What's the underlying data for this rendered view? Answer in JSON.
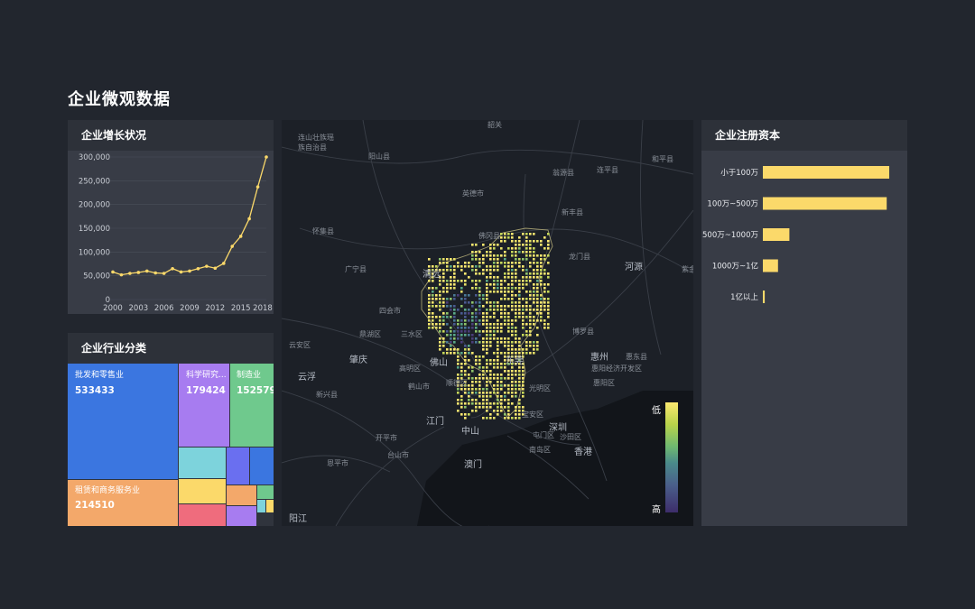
{
  "page": {
    "title": "企业微观数据"
  },
  "growth": {
    "title": "企业增长状况"
  },
  "industry": {
    "title": "企业行业分类",
    "cells": [
      {
        "label": "批发和零售业",
        "value": "533433",
        "color": "#3b76e0"
      },
      {
        "label": "科学研究...",
        "value": "179424",
        "color": "#a77cf0"
      },
      {
        "label": "制造业",
        "value": "152579",
        "color": "#6fc98d"
      },
      {
        "label": "租赁和商务服务业",
        "value": "214510",
        "color": "#f3a86a"
      }
    ],
    "minor_colors": [
      "#7dd3dc",
      "#6a6ff0",
      "#3b76e0",
      "#fbd96a",
      "#f3a86a",
      "#ef6c7d",
      "#a77cf0",
      "#6fc98d",
      "#7dd3dc",
      "#fbd96a"
    ]
  },
  "map": {
    "legend": {
      "low": "低",
      "high": "高"
    },
    "places": [
      "连山壮族瑶族自治县",
      "阳山县",
      "英德市",
      "翁源县",
      "连平县",
      "和平县",
      "怀集县",
      "佛冈县",
      "新丰县",
      "广宁县",
      "清远",
      "龙门县",
      "河源",
      "紫金",
      "四会市",
      "鼎湖区",
      "三水区",
      "博罗县",
      "云安区",
      "肇庆",
      "佛山",
      "东莞",
      "惠州",
      "惠东县",
      "高明区",
      "惠阳经济开发区",
      "云浮",
      "鹤山市",
      "顺德区",
      "惠阳区",
      "光明区",
      "新兴县",
      "江门",
      "宝安区",
      "中山",
      "深圳",
      "开平市",
      "屯门区",
      "沙田区",
      "台山市",
      "南岛区",
      "香港",
      "恩平市",
      "澳门",
      "阳江",
      "韶关"
    ],
    "colors": {
      "low": "#fbe870",
      "high": "#3d2d6b"
    }
  },
  "capital": {
    "title": "企业注册资本"
  },
  "chart_data": [
    {
      "type": "line",
      "title": "企业增长状况",
      "x": [
        2000,
        2001,
        2002,
        2003,
        2004,
        2005,
        2006,
        2007,
        2008,
        2009,
        2010,
        2011,
        2012,
        2013,
        2014,
        2015,
        2016,
        2017,
        2018
      ],
      "series": [
        {
          "values": [
            58000,
            52000,
            55000,
            57000,
            60000,
            56000,
            55000,
            65000,
            58000,
            60000,
            65000,
            70000,
            66000,
            76000,
            112000,
            133000,
            170000,
            237000,
            300000
          ]
        }
      ],
      "x_ticks": [
        "2000",
        "2003",
        "2006",
        "2009",
        "2012",
        "2015",
        "2018"
      ],
      "y_ticks": [
        "0",
        "50,000",
        "100,000",
        "150,000",
        "200,000",
        "250,000",
        "300,000"
      ],
      "ylim": [
        0,
        300000
      ],
      "xlim": [
        2000,
        2018
      ],
      "grid": true,
      "color": "#fbd96a"
    },
    {
      "type": "bar",
      "orientation": "horizontal",
      "title": "企业注册资本",
      "categories": [
        "小于100万",
        "100万~500万",
        "500万~1000万",
        "1000万~1亿",
        "1亿以上"
      ],
      "values": [
        100,
        98,
        21,
        12,
        1.5
      ],
      "xlim": [
        0,
        100
      ],
      "color": "#fbd96a"
    },
    {
      "type": "heatmap",
      "title": "",
      "legend": [
        "低",
        "高"
      ]
    }
  ]
}
